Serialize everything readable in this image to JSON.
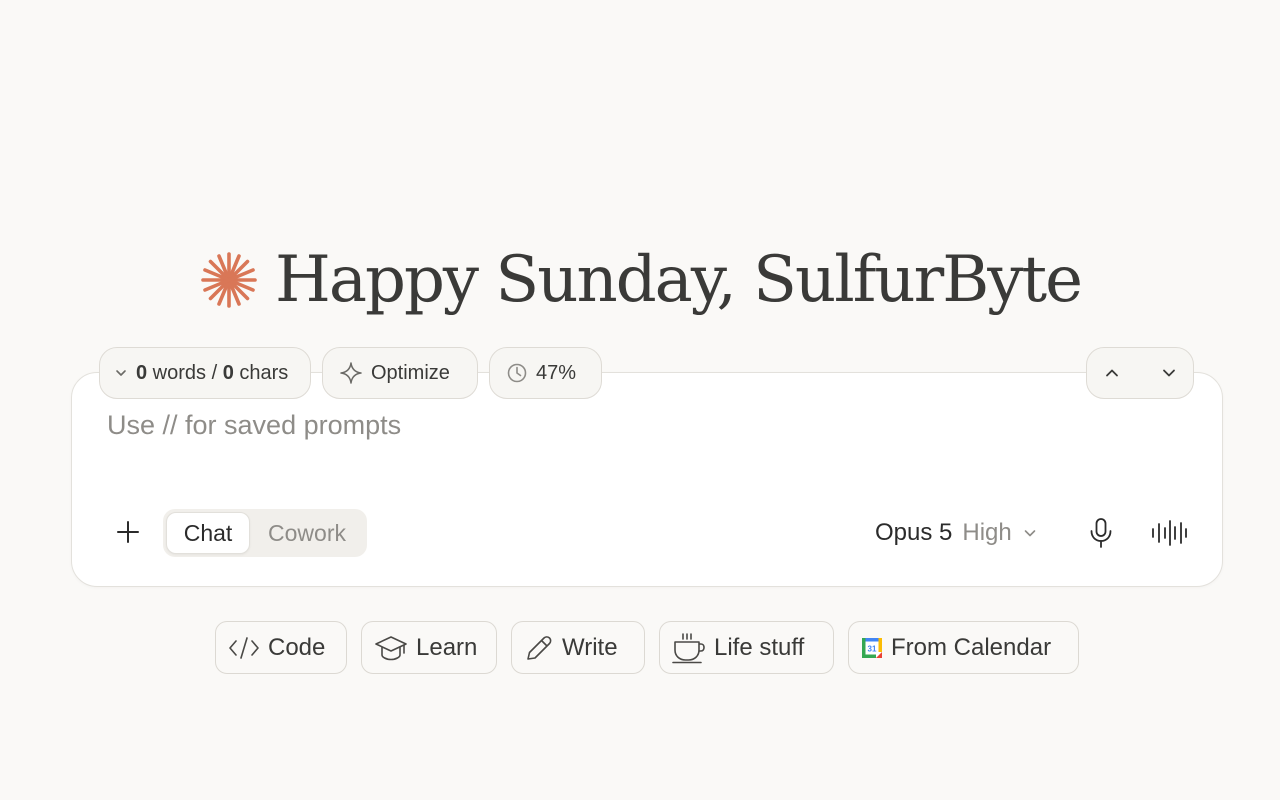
{
  "greeting": {
    "text": "Happy Sunday, SulfurByte",
    "logo_icon": "sparkle-asterisk-icon",
    "accent_color": "#d97757"
  },
  "toolbar": {
    "word_count": {
      "words": "0",
      "words_label": " words / ",
      "chars": "0",
      "chars_label": " chars",
      "icon": "chevron-down-icon"
    },
    "optimize": {
      "label": "Optimize",
      "icon": "sparkle-icon"
    },
    "usage": {
      "label": "47%",
      "value_percent": 47,
      "icon": "usage-gauge-icon"
    },
    "nav": {
      "up_icon": "chevron-up-icon",
      "down_icon": "chevron-down-icon"
    }
  },
  "composer": {
    "placeholder": "Use // for saved prompts",
    "add_icon": "plus-icon",
    "modes": [
      {
        "label": "Chat",
        "active": true
      },
      {
        "label": "Cowork",
        "active": false
      }
    ],
    "model": {
      "name": "Opus 5",
      "effort": "High",
      "icon": "chevron-down-icon"
    },
    "mic_icon": "microphone-icon",
    "voice_icon": "voice-waveform-icon"
  },
  "suggestions": [
    {
      "label": "Code",
      "icon": "code-icon"
    },
    {
      "label": "Learn",
      "icon": "graduation-cap-icon"
    },
    {
      "label": "Write",
      "icon": "pencil-icon"
    },
    {
      "label": "Life stuff",
      "icon": "coffee-cup-icon"
    },
    {
      "label": "From Calendar",
      "icon": "calendar-icon",
      "calendar_day": "31"
    }
  ]
}
